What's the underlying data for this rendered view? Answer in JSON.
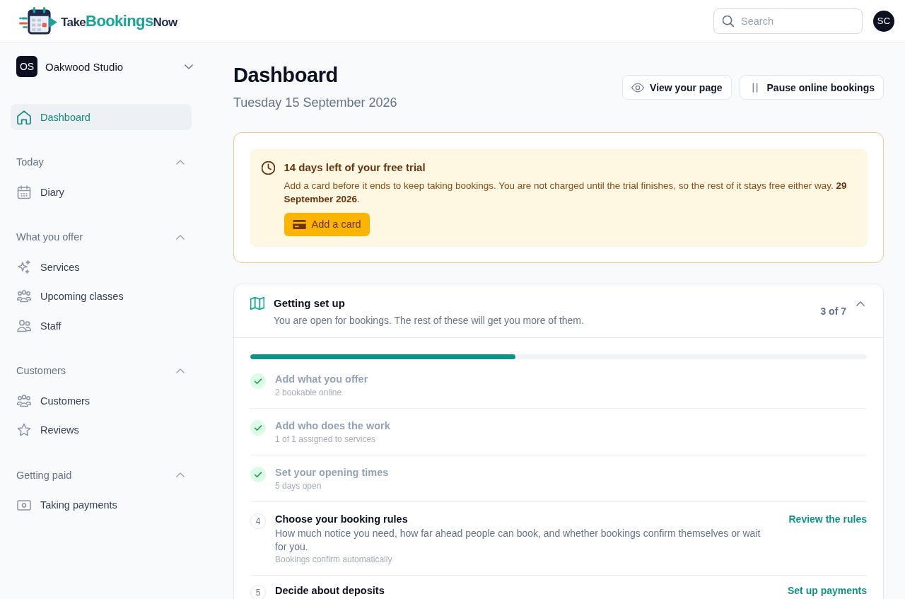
{
  "header": {
    "logo": [
      "Take",
      "Bookings",
      "Now"
    ],
    "search": {
      "placeholder": "Search"
    },
    "avatar": "SC"
  },
  "sidebar": {
    "workspace": {
      "initials": "OS",
      "name": "Oakwood Studio"
    },
    "items": [
      {
        "label": "Dashboard",
        "selected": true
      }
    ],
    "sections": [
      {
        "title": "Today",
        "expanded": true,
        "items": [
          {
            "label": "Diary",
            "selected": false
          }
        ]
      },
      {
        "title": "What you offer",
        "expanded": true,
        "items": [
          {
            "label": "Services",
            "selected": false
          },
          {
            "label": "Upcoming classes",
            "selected": false
          },
          {
            "label": "Staff",
            "selected": false
          }
        ]
      },
      {
        "title": "Customers",
        "expanded": true,
        "items": [
          {
            "label": "Customers",
            "selected": false
          },
          {
            "label": "Reviews",
            "selected": false
          }
        ]
      },
      {
        "title": "Getting paid",
        "expanded": true,
        "items": [
          {
            "label": "Taking payments",
            "selected": false
          }
        ]
      }
    ]
  },
  "page": {
    "title": "Dashboard",
    "date": "Tuesday 15 September 2026",
    "actions": [
      "View your page",
      "Pause online bookings"
    ]
  },
  "trial_notice": {
    "title": "14 days left of your free trial",
    "message": "Add a card before it ends to keep taking bookings. You are not charged until the trial finishes, so the rest of it stays free either way. **29 September 2026**.",
    "button": "Add a card"
  },
  "setup": {
    "title": "Getting set up",
    "subtitle": "You are open for bookings. The rest of these will get you more of them.",
    "count": "3 of 7",
    "expanded": true,
    "progress": {
      "level": 0.43
    },
    "steps": [
      {
        "done": true,
        "title": "Add what you offer",
        "note": "2 bookable online"
      },
      {
        "done": true,
        "title": "Add who does the work",
        "note": "1 of 1 assigned to services"
      },
      {
        "done": true,
        "title": "Set your opening times",
        "note": "5 days open"
      },
      {
        "done": false,
        "number": "4",
        "title": "Choose your booking rules",
        "description": "How much notice you need, how far ahead people can book, and whether bookings confirm themselves or wait for you.",
        "note": "Bookings confirm automatically",
        "action": "Review the rules"
      },
      {
        "done": false,
        "number": "5",
        "title": "Decide about deposits",
        "action": "Set up payments"
      }
    ]
  }
}
